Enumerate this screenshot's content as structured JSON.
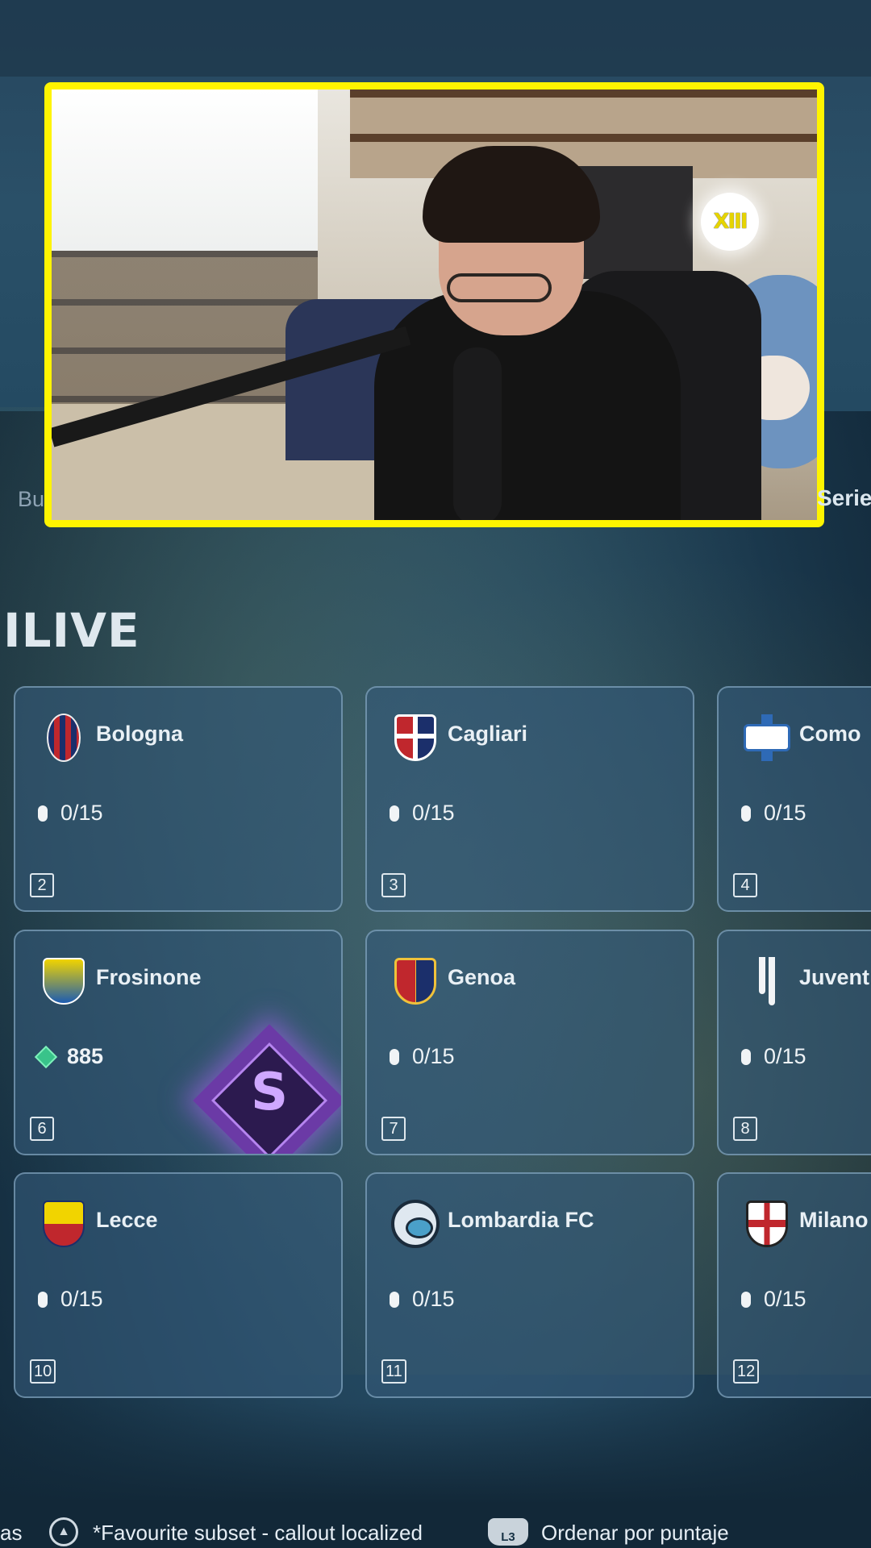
{
  "nav": {
    "left_label": "Bu",
    "right_label": "Serie"
  },
  "overlay": {
    "logo_text": "XIII"
  },
  "section": {
    "title": "ILIVE"
  },
  "cards": [
    {
      "name": "Bologna",
      "progress": "0/15",
      "index": "2",
      "crest": "bologna-crest-icon"
    },
    {
      "name": "Cagliari",
      "progress": "0/15",
      "index": "3",
      "crest": "cagliari-crest-icon"
    },
    {
      "name": "Como",
      "progress": "0/15",
      "index": "4",
      "crest": "como-crest-icon"
    },
    {
      "name": "Frosinone",
      "points": "885",
      "index": "6",
      "rank": "S",
      "crest": "frosinone-crest-icon"
    },
    {
      "name": "Genoa",
      "progress": "0/15",
      "index": "7",
      "crest": "genoa-crest-icon"
    },
    {
      "name": "Juvent",
      "progress": "0/15",
      "index": "8",
      "crest": "juventus-crest-icon"
    },
    {
      "name": "Lecce",
      "progress": "0/15",
      "index": "10",
      "crest": "lecce-crest-icon"
    },
    {
      "name": "Lombardia FC",
      "progress": "0/15",
      "index": "11",
      "crest": "lombardia-crest-icon"
    },
    {
      "name": "Milano",
      "progress": "0/15",
      "index": "12",
      "crest": "milano-crest-icon"
    }
  ],
  "hints": {
    "cut_text": "as",
    "triangle_label": "*Favourite subset - callout localized",
    "l3_button": "L3",
    "l3_label": "Ordenar por puntaje"
  },
  "colors": {
    "overlay_border": "#fff400",
    "card_bg": "#345878",
    "rank_purple": "#6b3aa6"
  }
}
